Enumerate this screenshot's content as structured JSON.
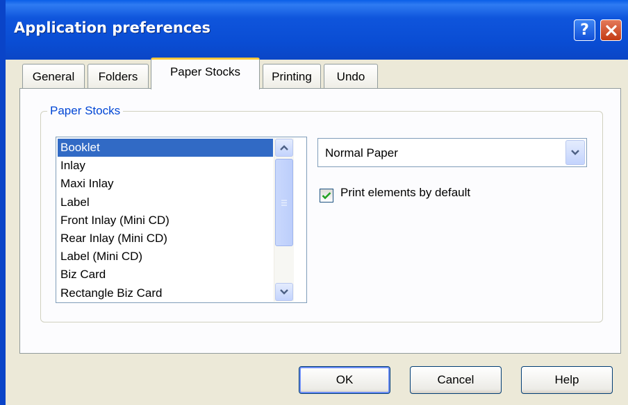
{
  "window": {
    "title": "Application preferences",
    "help_glyph": "?",
    "help_icon": "help-icon",
    "close_icon": "close-icon",
    "title_bar_color": "#0a4dd4"
  },
  "tabs": [
    {
      "label": "General",
      "selected": false
    },
    {
      "label": "Folders",
      "selected": false
    },
    {
      "label": "Paper Stocks",
      "selected": true
    },
    {
      "label": "Printing",
      "selected": false
    },
    {
      "label": "Undo",
      "selected": false
    }
  ],
  "paper_stocks": {
    "group_label": "Paper Stocks",
    "list_items": [
      "Booklet",
      "Inlay",
      "Maxi Inlay",
      "Label",
      "Front Inlay (Mini CD)",
      "Rear Inlay (Mini CD)",
      "Label (Mini CD)",
      "Biz Card",
      "Rectangle Biz Card"
    ],
    "selected_item": "Booklet",
    "selection_color": "#316ac5",
    "paper_type_value": "Normal Paper",
    "print_elements_label": "Print elements by default",
    "print_elements_checked": true
  },
  "buttons": {
    "ok": "OK",
    "cancel": "Cancel",
    "help": "Help"
  }
}
